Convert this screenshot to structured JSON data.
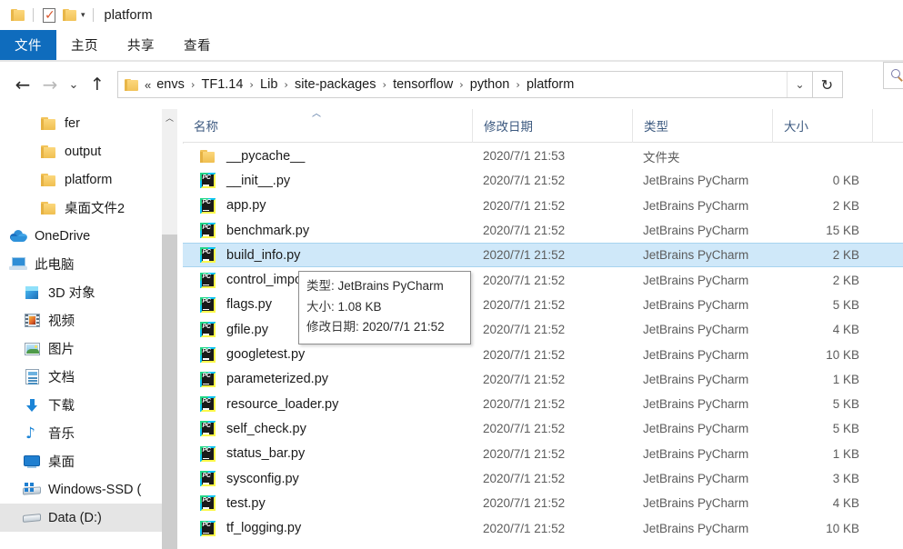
{
  "window": {
    "title": "platform",
    "quick_access_icons": [
      "folder-icon",
      "properties-icon",
      "new-folder-icon",
      "customize-dropdown-icon"
    ]
  },
  "ribbon": {
    "tabs": [
      {
        "label": "文件",
        "active": true
      },
      {
        "label": "主页",
        "active": false
      },
      {
        "label": "共享",
        "active": false
      },
      {
        "label": "查看",
        "active": false
      }
    ]
  },
  "navbar": {
    "back": "←",
    "forward": "→",
    "recent": "⌄",
    "up": "↑",
    "refresh": "↻",
    "dropdown": "⌄",
    "ellipsis": "«",
    "separator": "›",
    "breadcrumbs": [
      "envs",
      "TF1.14",
      "Lib",
      "site-packages",
      "tensorflow",
      "python",
      "platform"
    ]
  },
  "navpane": {
    "items": [
      {
        "label": "fer",
        "icon": "folder-icon",
        "indent": 3,
        "selected": false
      },
      {
        "label": "output",
        "icon": "folder-icon",
        "indent": 3,
        "selected": false
      },
      {
        "label": "platform",
        "icon": "folder-icon",
        "indent": 3,
        "selected": false
      },
      {
        "label": "桌面文件2",
        "icon": "folder-icon",
        "indent": 3,
        "selected": false
      },
      {
        "label": "OneDrive",
        "icon": "onedrive-icon",
        "indent": 1,
        "selected": false
      },
      {
        "label": "此电脑",
        "icon": "this-pc-icon",
        "indent": 1,
        "selected": false
      },
      {
        "label": "3D 对象",
        "icon": "3d-objects-icon",
        "indent": 2,
        "selected": false
      },
      {
        "label": "视频",
        "icon": "videos-icon",
        "indent": 2,
        "selected": false
      },
      {
        "label": "图片",
        "icon": "pictures-icon",
        "indent": 2,
        "selected": false
      },
      {
        "label": "文档",
        "icon": "documents-icon",
        "indent": 2,
        "selected": false
      },
      {
        "label": "下载",
        "icon": "downloads-icon",
        "indent": 2,
        "selected": false
      },
      {
        "label": "音乐",
        "icon": "music-icon",
        "indent": 2,
        "selected": false
      },
      {
        "label": "桌面",
        "icon": "desktop-icon",
        "indent": 2,
        "selected": false
      },
      {
        "label": "Windows-SSD (",
        "icon": "windows-ssd-icon",
        "indent": 2,
        "selected": false
      },
      {
        "label": "Data (D:)",
        "icon": "drive-icon",
        "indent": 2,
        "selected": true
      }
    ]
  },
  "filelist": {
    "columns": [
      {
        "label": "名称",
        "sorted": true,
        "sort_dir": "asc"
      },
      {
        "label": "修改日期",
        "sorted": false
      },
      {
        "label": "类型",
        "sorted": false
      },
      {
        "label": "大小",
        "sorted": false
      }
    ],
    "rows": [
      {
        "name": "__pycache__",
        "icon": "folder-icon",
        "date": "2020/7/1 21:53",
        "type": "文件夹",
        "size": "",
        "selected": false
      },
      {
        "name": "__init__.py",
        "icon": "pycharm-file-icon",
        "date": "2020/7/1 21:52",
        "type": "JetBrains PyCharm",
        "size": "0 KB",
        "selected": false
      },
      {
        "name": "app.py",
        "icon": "pycharm-file-icon",
        "date": "2020/7/1 21:52",
        "type": "JetBrains PyCharm",
        "size": "2 KB",
        "selected": false
      },
      {
        "name": "benchmark.py",
        "icon": "pycharm-file-icon",
        "date": "2020/7/1 21:52",
        "type": "JetBrains PyCharm",
        "size": "15 KB",
        "selected": false
      },
      {
        "name": "build_info.py",
        "icon": "pycharm-file-icon",
        "date": "2020/7/1 21:52",
        "type": "JetBrains PyCharm",
        "size": "2 KB",
        "selected": true
      },
      {
        "name": "control_imports.py",
        "icon": "pycharm-file-icon",
        "date": "2020/7/1 21:52",
        "type": "JetBrains PyCharm",
        "size": "2 KB",
        "selected": false
      },
      {
        "name": "flags.py",
        "icon": "pycharm-file-icon",
        "date": "2020/7/1 21:52",
        "type": "JetBrains PyCharm",
        "size": "5 KB",
        "selected": false
      },
      {
        "name": "gfile.py",
        "icon": "pycharm-file-icon",
        "date": "2020/7/1 21:52",
        "type": "JetBrains PyCharm",
        "size": "4 KB",
        "selected": false
      },
      {
        "name": "googletest.py",
        "icon": "pycharm-file-icon",
        "date": "2020/7/1 21:52",
        "type": "JetBrains PyCharm",
        "size": "10 KB",
        "selected": false
      },
      {
        "name": "parameterized.py",
        "icon": "pycharm-file-icon",
        "date": "2020/7/1 21:52",
        "type": "JetBrains PyCharm",
        "size": "1 KB",
        "selected": false
      },
      {
        "name": "resource_loader.py",
        "icon": "pycharm-file-icon",
        "date": "2020/7/1 21:52",
        "type": "JetBrains PyCharm",
        "size": "5 KB",
        "selected": false
      },
      {
        "name": "self_check.py",
        "icon": "pycharm-file-icon",
        "date": "2020/7/1 21:52",
        "type": "JetBrains PyCharm",
        "size": "5 KB",
        "selected": false
      },
      {
        "name": "status_bar.py",
        "icon": "pycharm-file-icon",
        "date": "2020/7/1 21:52",
        "type": "JetBrains PyCharm",
        "size": "1 KB",
        "selected": false
      },
      {
        "name": "sysconfig.py",
        "icon": "pycharm-file-icon",
        "date": "2020/7/1 21:52",
        "type": "JetBrains PyCharm",
        "size": "3 KB",
        "selected": false
      },
      {
        "name": "test.py",
        "icon": "pycharm-file-icon",
        "date": "2020/7/1 21:52",
        "type": "JetBrains PyCharm",
        "size": "4 KB",
        "selected": false
      },
      {
        "name": "tf_logging.py",
        "icon": "pycharm-file-icon",
        "date": "2020/7/1 21:52",
        "type": "JetBrains PyCharm",
        "size": "10 KB",
        "selected": false
      }
    ]
  },
  "tooltip": {
    "lines": [
      {
        "key": "类型: ",
        "value": "JetBrains PyCharm"
      },
      {
        "key": "大小: ",
        "value": "1.08 KB"
      },
      {
        "key": "修改日期: ",
        "value": "2020/7/1 21:52"
      }
    ]
  },
  "colors": {
    "accent": "#0f6cbd",
    "selection": "#cfe8f9",
    "selection_border": "#a8d4ef",
    "nav_selection": "#e5e5e5",
    "header_text": "#3d5a80",
    "folder_yellow": "#f2c359",
    "scrollbar_thumb": "#cdcdcd"
  }
}
